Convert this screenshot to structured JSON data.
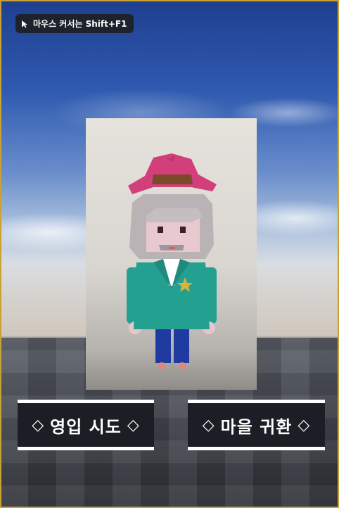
{
  "tooltip": {
    "icon": "cursor-arrow-icon",
    "text": "마우스 커서는 Shift+F1"
  },
  "buttons": {
    "enter": {
      "left_icon": "◇",
      "label": "영입 시도",
      "right_icon": "◇"
    },
    "return": {
      "left_icon": "◇",
      "label": "마을 귀환",
      "right_icon": "◇"
    }
  },
  "colors": {
    "frame": "#c9a232",
    "button_bg": "#1b1e24",
    "button_border": "#ffffff",
    "hat": "#d23f7a",
    "shirt": "#24a091",
    "pants": "#1f3aa0"
  }
}
